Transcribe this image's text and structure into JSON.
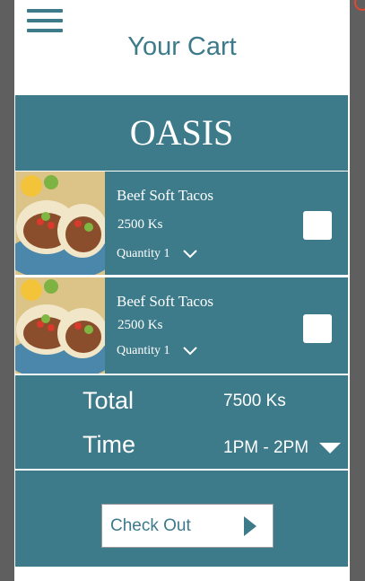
{
  "header": {
    "title": "Your Cart"
  },
  "store": {
    "name": "OASIS"
  },
  "cart": {
    "items": [
      {
        "name": "Beef Soft Tacos",
        "price": "2500 Ks",
        "quantity_label": "Quantity 1"
      },
      {
        "name": "Beef Soft Tacos",
        "price": "2500 Ks",
        "quantity_label": "Quantity 1"
      }
    ]
  },
  "summary": {
    "total_label": "Total",
    "total_value": "7500 Ks",
    "time_label": "Time",
    "time_value": "1PM - 2PM"
  },
  "checkout": {
    "label": "Check Out"
  },
  "icons": {
    "menu": "hamburger-menu-icon",
    "quantity_dropdown": "chevron-down-icon",
    "time_dropdown": "caret-down-icon",
    "checkout_arrow": "play-arrow-icon"
  },
  "colors": {
    "primary": "#3d7b8a",
    "background": "#ffffff",
    "surround": "#5f5f5f"
  }
}
